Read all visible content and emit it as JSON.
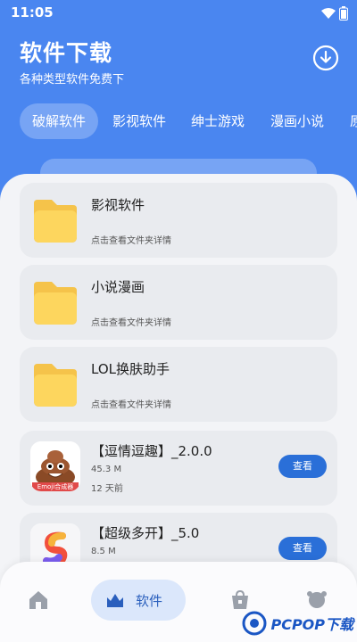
{
  "status": {
    "time": "11:05"
  },
  "header": {
    "title": "软件下载",
    "subtitle": "各种类型软件免费下"
  },
  "tabs": [
    {
      "label": "破解软件"
    },
    {
      "label": "影视软件"
    },
    {
      "label": "绅士游戏"
    },
    {
      "label": "漫画小说"
    },
    {
      "label": "原"
    }
  ],
  "folders": [
    {
      "name": "影视软件",
      "desc": "点击查看文件夹详情"
    },
    {
      "name": "小说漫画",
      "desc": "点击查看文件夹详情"
    },
    {
      "name": "LOL换肤助手",
      "desc": "点击查看文件夹详情"
    }
  ],
  "apps": [
    {
      "name": "【逗情逗趣】_2.0.0",
      "size": "45.3 M",
      "age": "12 天前",
      "button": "查看",
      "thumb_text": "Emoji合成器"
    },
    {
      "name": "【超级多开】_5.0",
      "size": "8.5 M",
      "age": "",
      "button": "查看"
    }
  ],
  "bottomnav": {
    "active_label": "软件"
  },
  "watermark": {
    "text": "PCPOP下载"
  }
}
